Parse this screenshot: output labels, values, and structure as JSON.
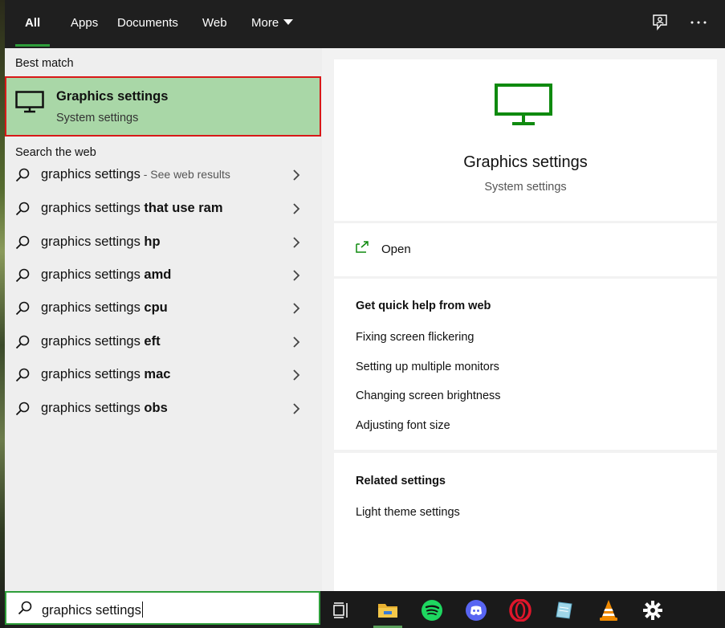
{
  "tabs": [
    {
      "label": "All",
      "active": true
    },
    {
      "label": "Apps"
    },
    {
      "label": "Documents"
    },
    {
      "label": "Web"
    },
    {
      "label": "More"
    }
  ],
  "topbar_icons": [
    "feedback-icon",
    "more-options-icon"
  ],
  "best_match": {
    "heading": "Best match",
    "title": "Graphics settings",
    "subtitle": "System settings",
    "icon": "monitor-icon"
  },
  "web": {
    "heading": "Search the web",
    "results": [
      {
        "base": "graphics settings",
        "bold": "",
        "suffix": " - See web results"
      },
      {
        "base": "graphics settings ",
        "bold": "that use ram",
        "suffix": ""
      },
      {
        "base": "graphics settings ",
        "bold": "hp",
        "suffix": ""
      },
      {
        "base": "graphics settings ",
        "bold": "amd",
        "suffix": ""
      },
      {
        "base": "graphics settings ",
        "bold": "cpu",
        "suffix": ""
      },
      {
        "base": "graphics settings ",
        "bold": "eft",
        "suffix": ""
      },
      {
        "base": "graphics settings ",
        "bold": "mac",
        "suffix": ""
      },
      {
        "base": "graphics settings ",
        "bold": "obs",
        "suffix": ""
      }
    ]
  },
  "search": {
    "value": "graphics settings"
  },
  "preview": {
    "title": "Graphics settings",
    "subtitle": "System settings",
    "open_label": "Open",
    "quick_help_heading": "Get quick help from web",
    "quick_help_links": [
      "Fixing screen flickering",
      "Setting up multiple monitors",
      "Changing screen brightness",
      "Adjusting font size"
    ],
    "related_heading": "Related settings",
    "related_links": [
      "Light theme settings"
    ]
  },
  "taskbar": [
    "task-view-icon",
    "file-explorer-icon",
    "spotify-icon",
    "discord-icon",
    "opera-icon",
    "notepad-icon",
    "vlc-icon",
    "settings-icon"
  ],
  "colors": {
    "accent": "#2e9e3a",
    "highlight": "#a9d7a7",
    "highlight_border": "#d81818",
    "monitor_green": "#0f8a0f"
  }
}
